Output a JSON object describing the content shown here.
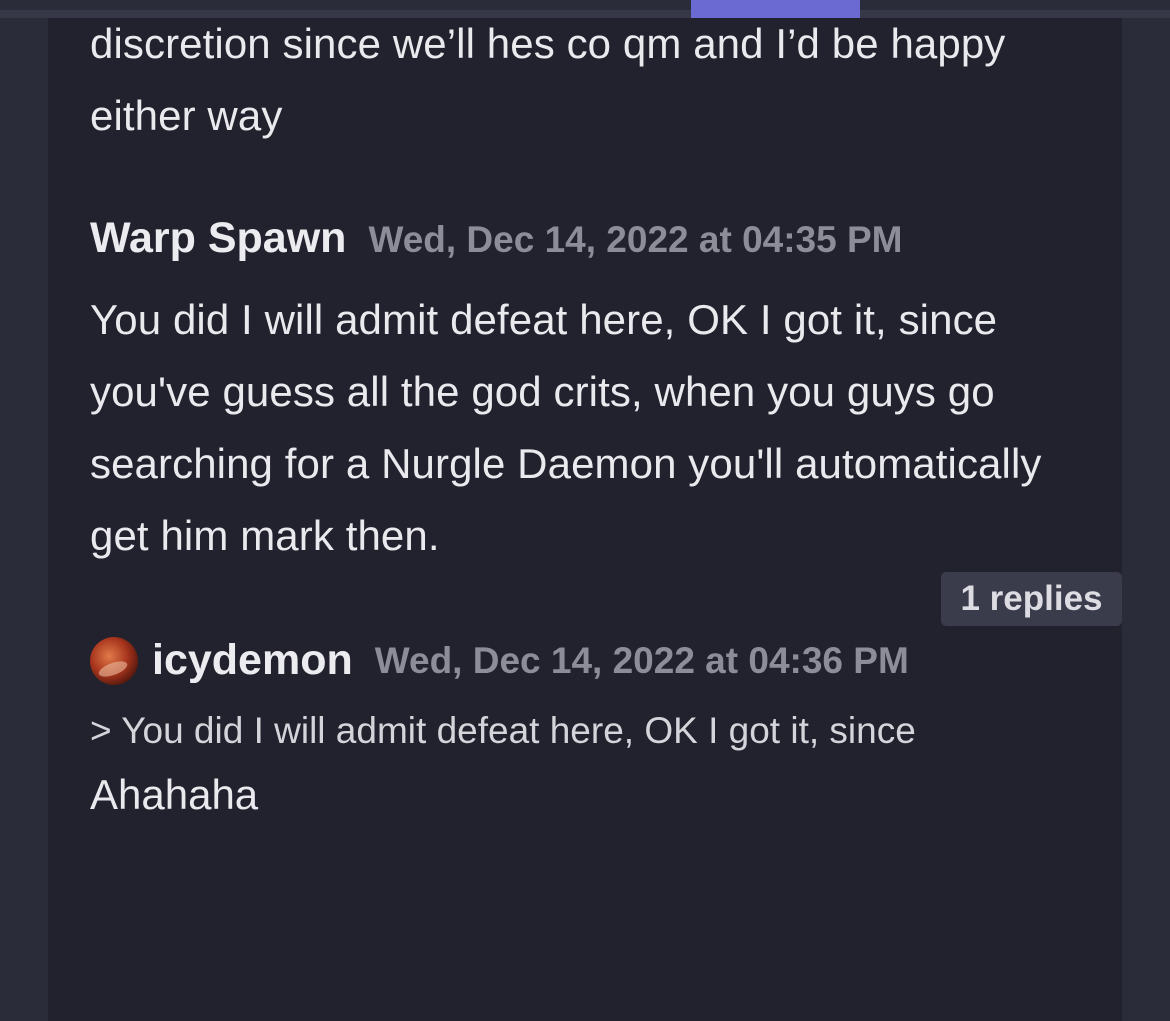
{
  "colors": {
    "background": "#2b2c3a",
    "panel": "#22222e",
    "accent": "#6a6ad2",
    "text": "#e9e9ee",
    "timestamp": "#8d8d99"
  },
  "previous_message": {
    "text": "discretion since we’ll hes co qm and I’d be happy either way"
  },
  "messages": [
    {
      "author": "Warp Spawn",
      "timestamp": "Wed, Dec 14, 2022 at 04:35 PM",
      "body": "You did I will admit defeat here, OK I got it, since you've guess all the god crits, when you guys go searching for a Nurgle Daemon you'll automatically get him mark then.",
      "replies_label": "1 replies"
    },
    {
      "author": "icydemon",
      "avatar_icon": "user-avatar-icon",
      "timestamp": "Wed, Dec 14, 2022 at 04:36 PM",
      "quote": "> You did I will admit defeat here, OK I got it, since",
      "body": "Ahahaha"
    }
  ]
}
